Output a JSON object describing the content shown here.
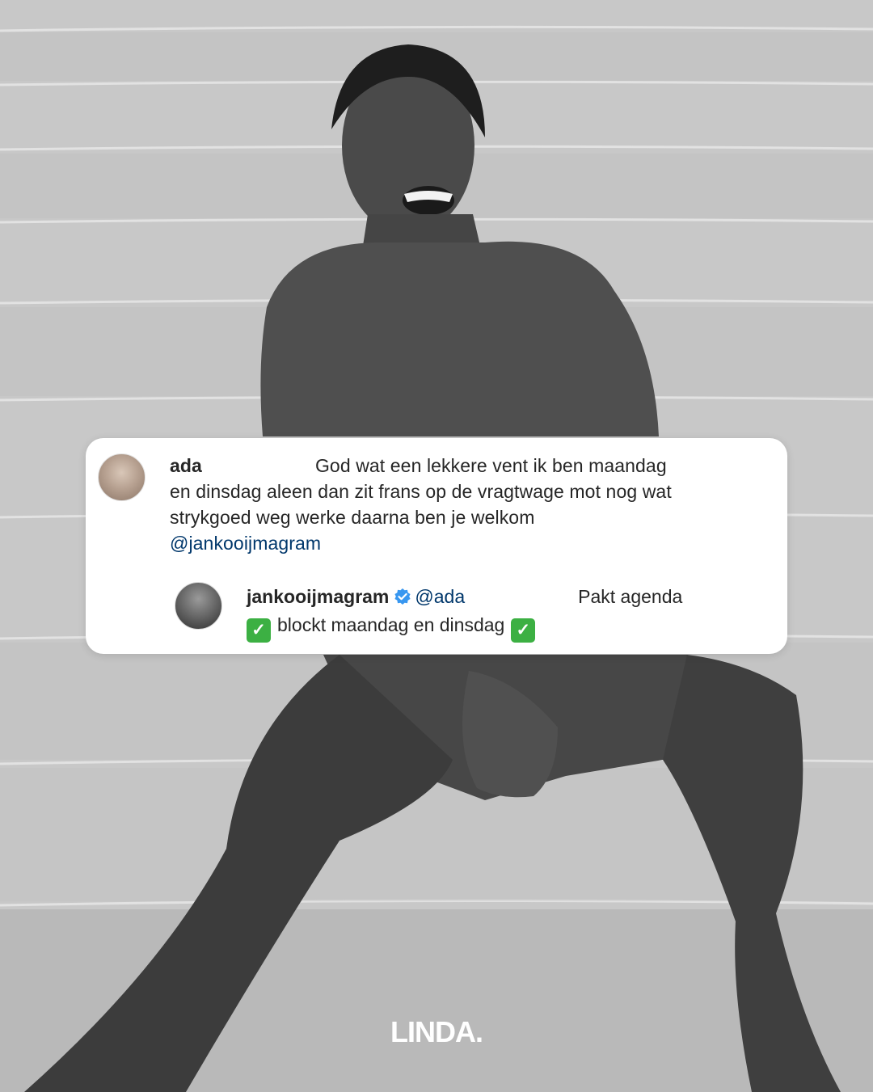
{
  "comment": {
    "username": "ada",
    "text_line1": "God wat een lekkere vent ik ben maandag",
    "text_rest": "en dinsdag aleen dan zit frans op de vragtwage mot nog wat strykgoed weg werke daarna ben je welkom",
    "mention": "@jankooijmagram"
  },
  "reply": {
    "username": "jankooijmagram",
    "verified_icon": "verified-badge-icon",
    "mention": "@ada",
    "text_line1": "Pakt agenda",
    "check_icon": "check-mark-emoji",
    "text_line2": "blockt maandag en dinsdag",
    "check_symbol": "✓"
  },
  "brand": {
    "logo_text": "LINDA."
  },
  "colors": {
    "mention": "#00376b",
    "verified": "#3897f0",
    "check": "#3cb043"
  }
}
